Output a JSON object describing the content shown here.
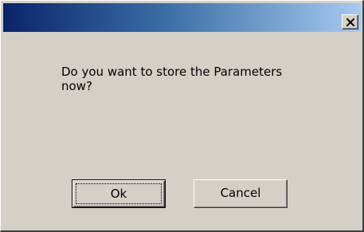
{
  "window": {
    "title": "",
    "close_icon": "close-icon"
  },
  "message": {
    "text": "Do you want to store the Parameters now?"
  },
  "buttons": {
    "ok_label": "Ok",
    "cancel_label": "Cancel"
  },
  "colors": {
    "title_start": "#0a246a",
    "title_end": "#a6caf0",
    "face": "#d4d0c8"
  }
}
